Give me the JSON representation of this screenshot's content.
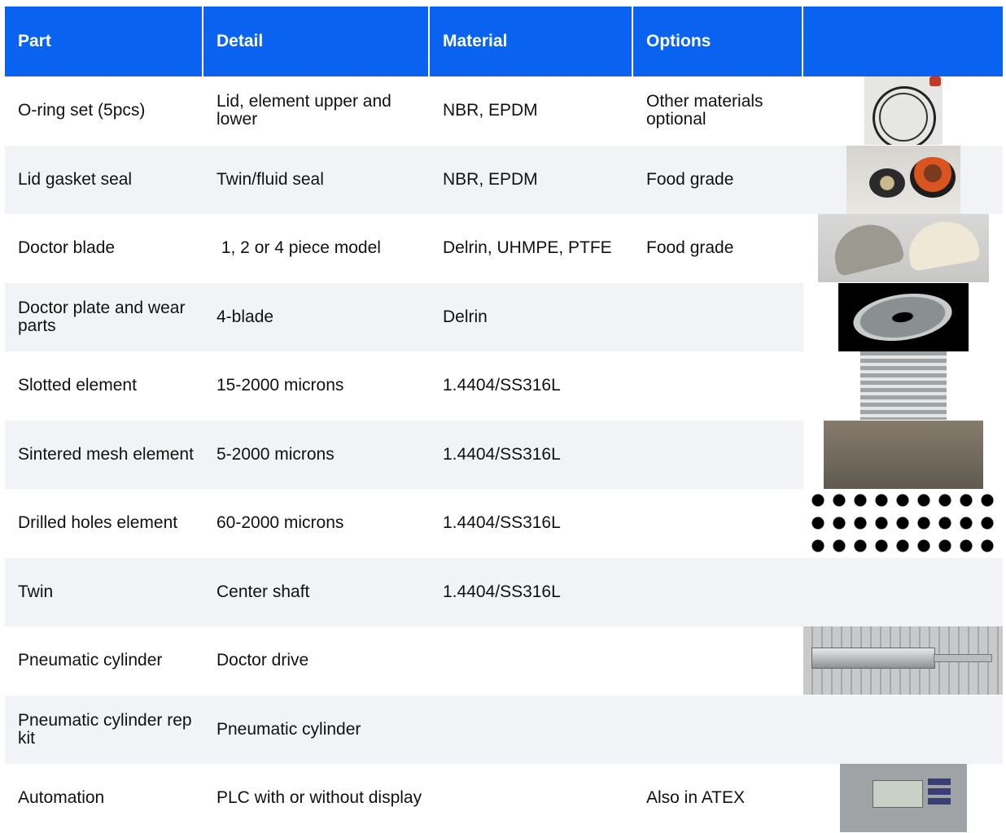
{
  "table": {
    "headers": [
      "Part",
      "Detail",
      "Material",
      "Options",
      ""
    ],
    "rows": [
      {
        "part": "O-ring set (5pcs)",
        "detail": "Lid, element upper and lower",
        "material": "NBR, EPDM",
        "options": "Other materials optional",
        "image": "o-ring-photo"
      },
      {
        "part": "Lid gasket seal",
        "detail": "Twin/fluid seal",
        "material": "NBR, EPDM",
        "options": "Food grade",
        "image": "gasket-seal-photo"
      },
      {
        "part": "Doctor blade",
        "detail": " 1, 2 or 4 piece model",
        "material": "Delrin, UHMPE, PTFE",
        "options": "Food grade",
        "image": "doctor-blade-photo"
      },
      {
        "part": "Doctor plate and wear parts",
        "detail": "4-blade",
        "material": "Delrin",
        "options": "",
        "image": "doctor-plate-photo"
      },
      {
        "part": "Slotted element",
        "detail": "15-2000 microns",
        "material": "1.4404/SS316L",
        "options": "",
        "image": "slotted-element-photo"
      },
      {
        "part": "Sintered mesh element",
        "detail": "5-2000 microns",
        "material": "1.4404/SS316L",
        "options": "",
        "image": "sintered-mesh-photo"
      },
      {
        "part": "Drilled holes element",
        "detail": "60-2000 microns",
        "material": "1.4404/SS316L",
        "options": "",
        "image": "drilled-holes-photo"
      },
      {
        "part": "Twin",
        "detail": "Center shaft",
        "material": "1.4404/SS316L",
        "options": "",
        "image": ""
      },
      {
        "part": "Pneumatic cylinder",
        "detail": "Doctor drive",
        "material": "",
        "options": "",
        "image": "pneumatic-cylinder-photo"
      },
      {
        "part": "Pneumatic cylinder rep kit",
        "detail": "Pneumatic cylinder",
        "material": "",
        "options": "",
        "image": ""
      },
      {
        "part": "Automation",
        "detail": "PLC with or without display",
        "material": "",
        "options": "Also in ATEX",
        "image": "plc-display-photo"
      }
    ]
  },
  "colors": {
    "header_bg": "#0a63f0",
    "header_text": "#ffffff",
    "stripe": "#f2f3f7"
  }
}
